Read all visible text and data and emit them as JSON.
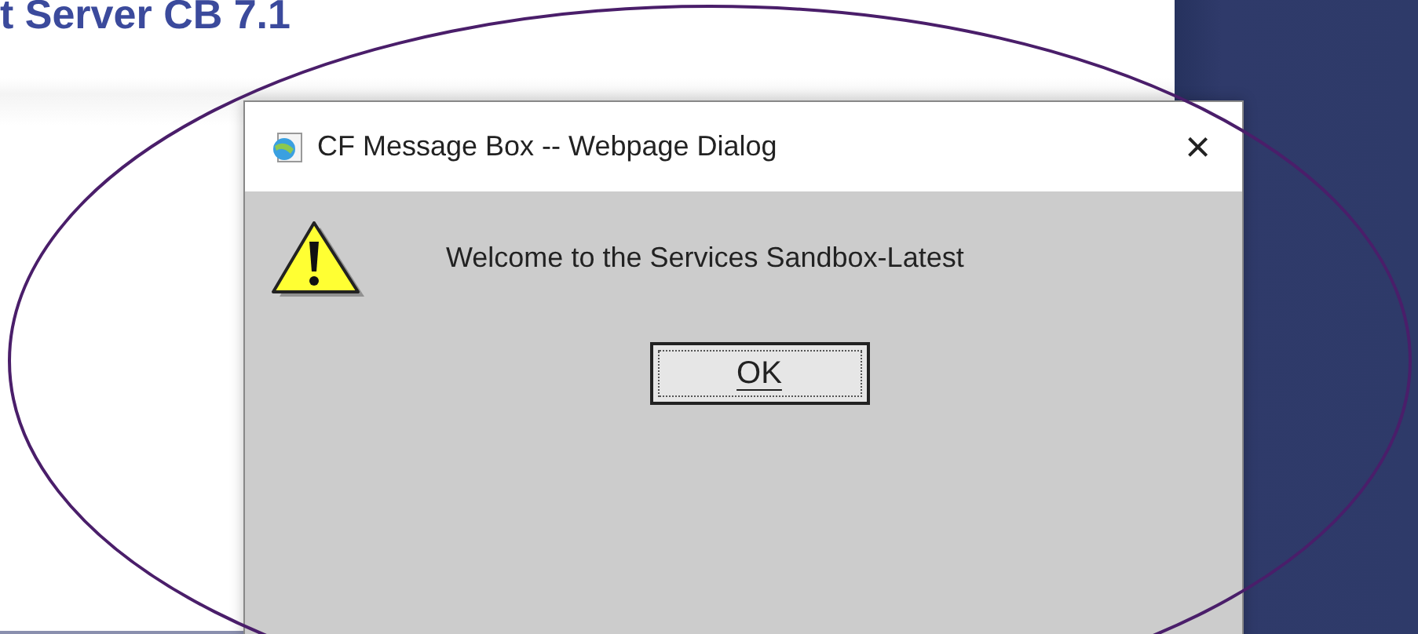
{
  "page": {
    "heading": "t Server CB 7.1"
  },
  "dialog": {
    "title": "CF Message Box -- Webpage Dialog",
    "close": "×",
    "message": "Welcome to the Services Sandbox-Latest",
    "buttons": [
      {
        "label": "OK",
        "selected": true
      }
    ]
  }
}
